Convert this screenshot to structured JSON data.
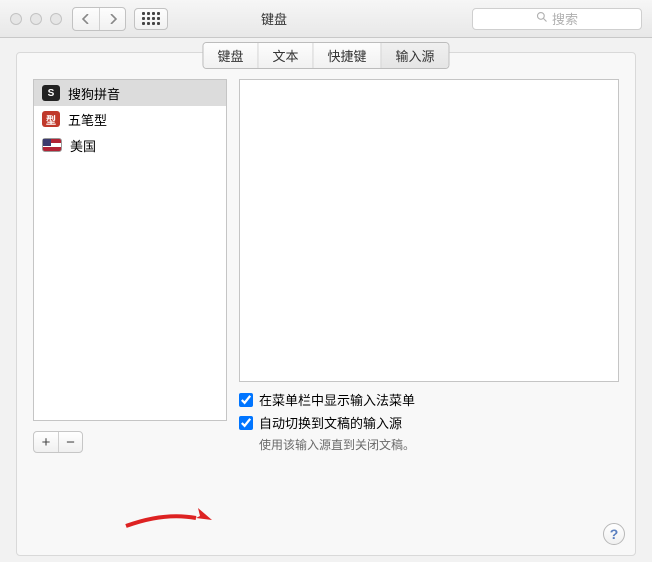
{
  "window": {
    "title": "键盘",
    "search_placeholder": "搜索"
  },
  "tabs": {
    "keyboard": "键盘",
    "text": "文本",
    "shortcuts": "快捷键",
    "input_sources": "输入源"
  },
  "input_sources": {
    "items": [
      {
        "name": "搜狗拼音",
        "icon": "sogou",
        "glyph": "S",
        "selected": true
      },
      {
        "name": "五笔型",
        "icon": "wubi",
        "glyph": "型",
        "selected": false
      },
      {
        "name": "美国",
        "icon": "us",
        "glyph": "",
        "selected": false
      }
    ]
  },
  "buttons": {
    "add": "+",
    "remove": "−",
    "help": "?"
  },
  "options": {
    "show_menu": {
      "label": "在菜单栏中显示输入法菜单",
      "checked": true
    },
    "auto_switch": {
      "label": "自动切换到文稿的输入源",
      "checked": true
    },
    "hint": "使用该输入源直到关闭文稿。"
  }
}
